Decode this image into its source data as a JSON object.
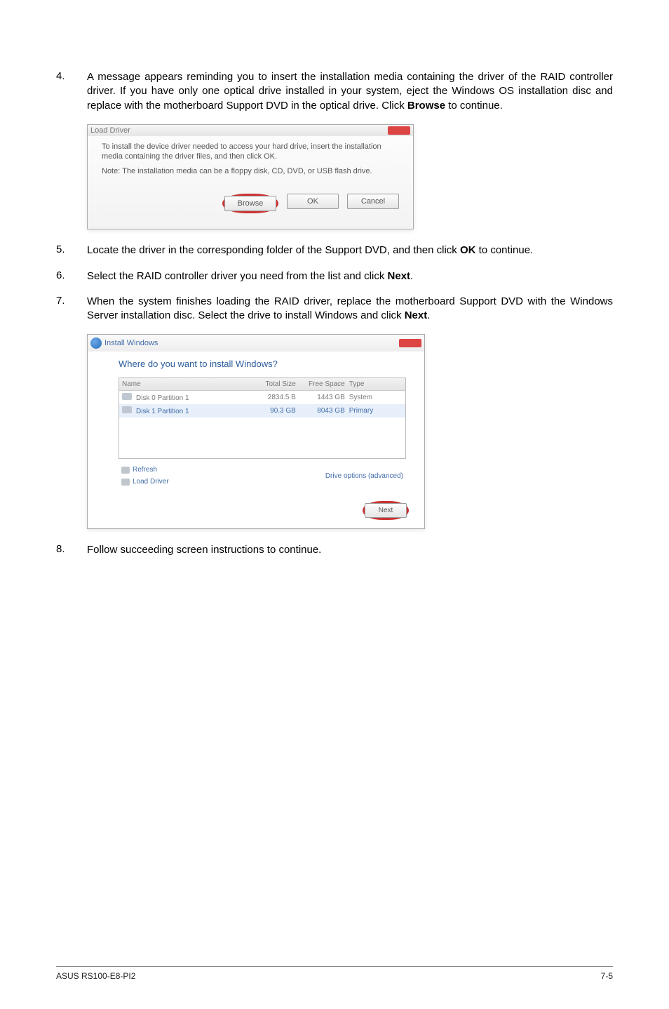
{
  "steps": {
    "s4": {
      "num": "4.",
      "text_a": "A message appears reminding you to insert the installation media containing the driver of the RAID controller driver. If you have only one optical drive installed in your system, eject the Windows OS installation disc and replace with the motherboard Support DVD in the optical drive. Click ",
      "bold": "Browse",
      "text_b": " to continue."
    },
    "s5": {
      "num": "5.",
      "text_a": "Locate the driver in the corresponding folder of the Support DVD, and then click ",
      "bold": "OK",
      "text_b": " to continue."
    },
    "s6": {
      "num": "6.",
      "text_a": "Select the RAID controller driver you need from the list and click ",
      "bold": "Next",
      "text_b": "."
    },
    "s7": {
      "num": "7.",
      "text_a": "When the system finishes loading the RAID driver, replace the motherboard Support DVD with the Windows Server installation disc. Select the drive to install Windows and click ",
      "bold": "Next",
      "text_b": "."
    },
    "s8": {
      "num": "8.",
      "text_a": "Follow succeeding screen instructions to continue."
    }
  },
  "load_driver": {
    "title": "Load Driver",
    "line1": "To install the device driver needed to access your hard drive, insert the installation media containing the driver files, and then click OK.",
    "line2": "Note: The installation media can be a floppy disk, CD, DVD, or USB flash drive.",
    "browse": "Browse",
    "ok": "OK",
    "cancel": "Cancel"
  },
  "install": {
    "tabtitle": "Install Windows",
    "heading": "Where do you want to install Windows?",
    "hdr_name": "Name",
    "hdr_size": "Total Size",
    "hdr_free": "Free Space",
    "hdr_type": "Type",
    "row0": {
      "name": "Disk 0 Partition 1",
      "size": "2834.5 B",
      "free": "1443 GB",
      "type": "System"
    },
    "row1": {
      "name": "Disk 1 Partition 1",
      "size": "90.3 GB",
      "free": "8043 GB",
      "type": "Primary"
    },
    "refresh": "Refresh",
    "load": "Load Driver",
    "adv": "Drive options (advanced)",
    "next": "Next"
  },
  "footer": {
    "left": "ASUS RS100-E8-PI2",
    "right": "7-5"
  }
}
